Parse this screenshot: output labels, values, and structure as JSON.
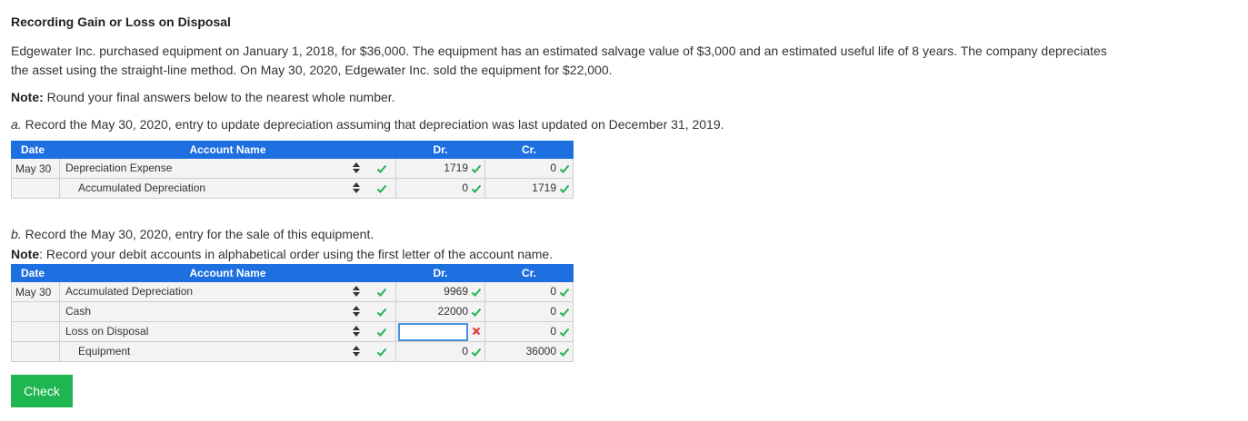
{
  "title": "Recording Gain or Loss on Disposal",
  "problem": {
    "line1": "Edgewater Inc. purchased equipment on January 1, 2018, for $36,000. The equipment has an estimated salvage value of $3,000 and an estimated useful life of 8 years. The company depreciates",
    "line2": "the asset using the straight-line method. On May 30, 2020, Edgewater Inc. sold the equipment for $22,000."
  },
  "note1": {
    "label": "Note:",
    "text": " Round your final answers below to the nearest whole number."
  },
  "part_a": {
    "letter": "a.",
    "text": " Record the May 30, 2020, entry to update depreciation assuming that depreciation was last updated on December 31, 2019."
  },
  "part_b": {
    "letter": "b.",
    "text": " Record the May 30, 2020, entry for the sale of this equipment.",
    "note_label": "Note",
    "note_text": ": Record your debit accounts in alphabetical order using the first letter of the account name."
  },
  "headers": {
    "date": "Date",
    "account": "Account Name",
    "dr": "Dr.",
    "cr": "Cr."
  },
  "table_a": [
    {
      "date": "May 30",
      "account": "Depreciation Expense",
      "dr": "1719",
      "cr": "0"
    },
    {
      "date": "",
      "account": "Accumulated Depreciation",
      "dr": "0",
      "cr": "1719"
    }
  ],
  "table_b": [
    {
      "date": "May 30",
      "account": "Accumulated Depreciation",
      "dr": "9969",
      "cr": "0"
    },
    {
      "date": "",
      "account": "Cash",
      "dr": "22000",
      "cr": "0"
    },
    {
      "date": "",
      "account": "Loss on Disposal",
      "dr": "",
      "cr": "0"
    },
    {
      "date": "",
      "account": "Equipment",
      "dr": "0",
      "cr": "36000"
    }
  ],
  "check_button": "Check",
  "colors": {
    "header": "#1e6fe0",
    "correct": "#1fb551",
    "incorrect": "#e23b3b",
    "button": "#1fb551"
  }
}
